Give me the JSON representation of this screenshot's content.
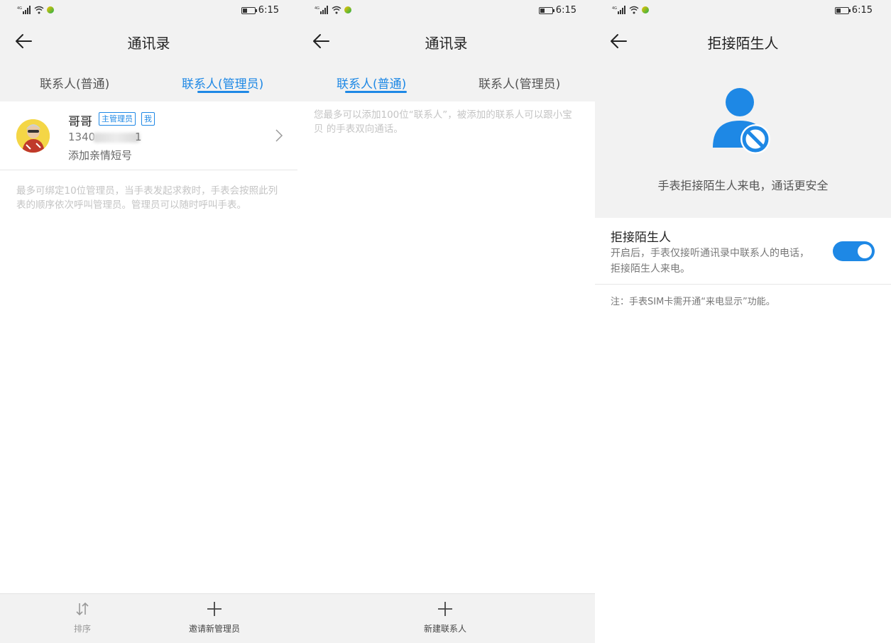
{
  "status": {
    "time": "6:15",
    "network": "4G"
  },
  "screens": [
    {
      "title": "通讯录",
      "tabs": [
        "联系人(普通)",
        "联系人(管理员)"
      ],
      "active_tab": 1,
      "contact": {
        "name": "哥哥",
        "badges": [
          "主管理员",
          "我"
        ],
        "phone_visible_start": "1340",
        "phone_visible_end": "1",
        "subtitle": "添加亲情短号"
      },
      "hint": "最多可绑定10位管理员，当手表发起求救时，手表会按照此列表的顺序依次呼叫管理员。管理员可以随时呼叫手表。",
      "bottom_actions": [
        {
          "label": "排序",
          "icon": "sort-icon"
        },
        {
          "label": "邀请新管理员",
          "icon": "plus-icon"
        }
      ]
    },
    {
      "title": "通讯录",
      "tabs": [
        "联系人(普通)",
        "联系人(管理员)"
      ],
      "active_tab": 0,
      "hint": "您最多可以添加100位“联系人”，被添加的联系人可以跟小宝贝 的手表双向通话。",
      "bottom_actions": [
        {
          "label": "新建联系人",
          "icon": "plus-icon"
        }
      ]
    },
    {
      "title": "拒接陌生人",
      "hero_text": "手表拒接陌生人来电，通话更安全",
      "setting": {
        "title": "拒接陌生人",
        "description": "开启后，手表仅接听通讯录中联系人的电话，拒接陌生人来电。",
        "enabled": true
      },
      "note": "注：手表SIM卡需开通“来电显示”功能。"
    }
  ],
  "colors": {
    "accent": "#1e88e5",
    "background_gray": "#f2f2f2",
    "hint_text": "#c4c4c4"
  }
}
